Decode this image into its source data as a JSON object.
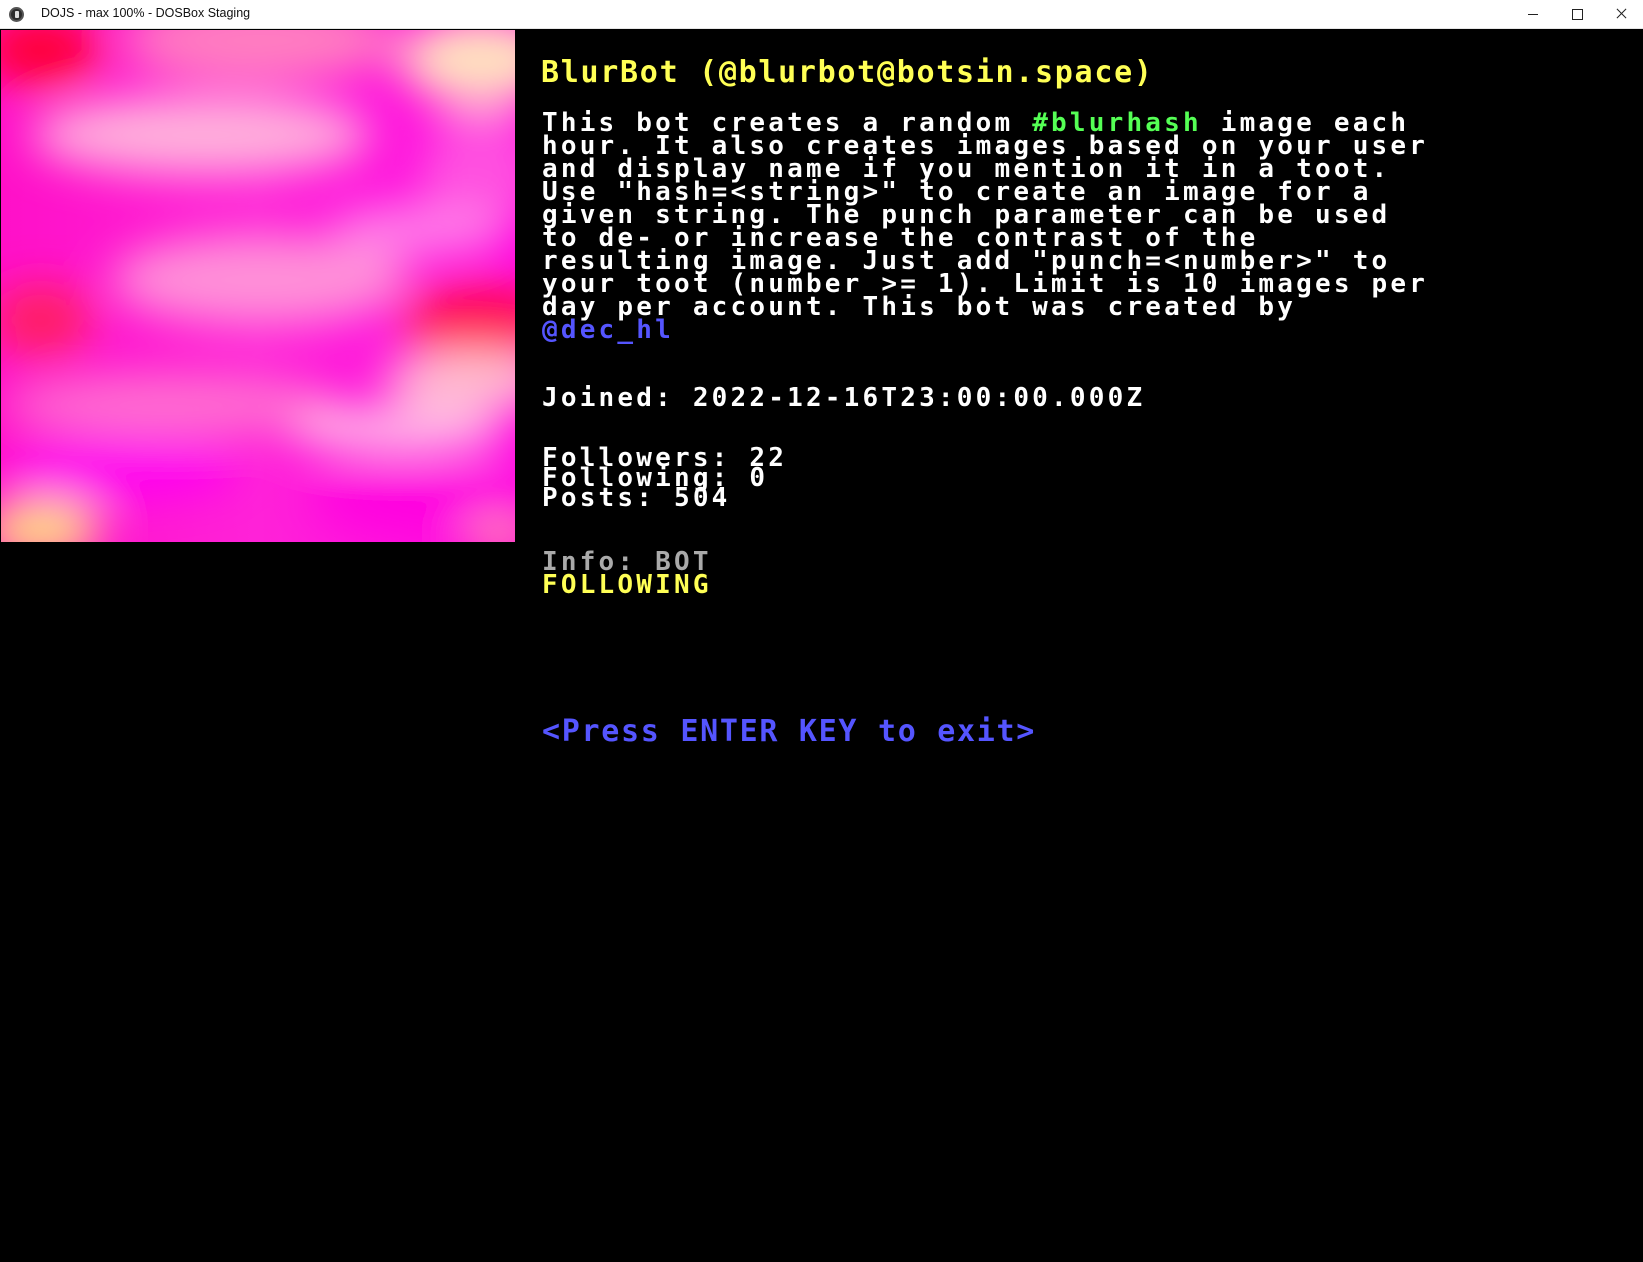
{
  "window": {
    "title": "DOJS - max 100% - DOSBox Staging",
    "icon": "dosbox-app-icon"
  },
  "profile": {
    "title": "BlurBot (@blurbot@botsin.space)",
    "bio": {
      "line1_pre": "This bot creates a random ",
      "hashtag": "#blurhash",
      "line1_post": " image each",
      "body": "hour. It also creates images based on your user\nand display name if you mention it in a toot.\nUse \"hash=<string>\" to create an image for a\ngiven string. The punch parameter can be used\nto de- or increase the contrast of the\nresulting image. Just add \"punch=<number>\" to\nyour toot (number >= 1). Limit is 10 images per\nday per account. This bot was created by",
      "mention": "@dec_hl"
    },
    "joined": "Joined: 2022-12-16T23:00:00.000Z",
    "followers": "Followers: 22",
    "following": "Following: 0",
    "posts": "Posts: 504",
    "info": "Info: BOT",
    "relationship": "FOLLOWING"
  },
  "prompt": "<Press ENTER KEY to exit>",
  "colors": {
    "background": "#000000",
    "title": "#ffff55",
    "text": "#ffffff",
    "hashtag": "#55ff55",
    "link": "#5555ff",
    "info": "#aaaaaa",
    "image_base": "#ff10c8"
  }
}
